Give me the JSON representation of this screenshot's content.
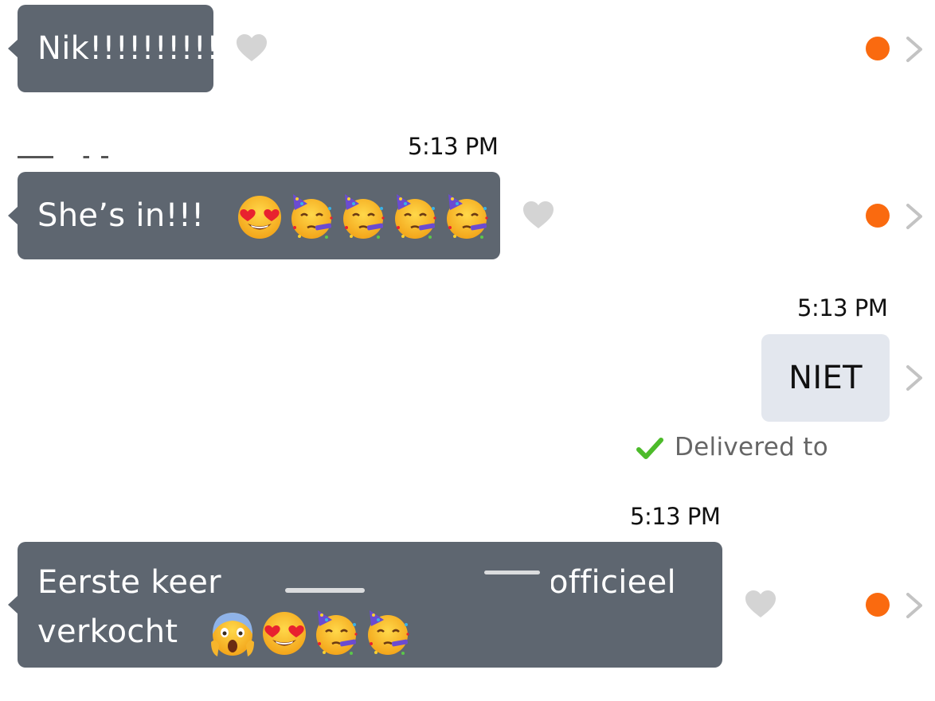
{
  "colors": {
    "incoming_bubble": "#5e6670",
    "outgoing_bubble": "#e3e7ee",
    "unread_dot": "#fa6a0f",
    "heart": "#d4d4d4",
    "chevron": "#c3c3c3",
    "delivered_check": "#4cbb2a"
  },
  "messages": [
    {
      "direction": "incoming",
      "text": "Nik!!!!!!!!!!",
      "emojis": [],
      "liked_icon": "heart-icon",
      "unread": true
    },
    {
      "direction": "incoming",
      "timestamp": "5:13 PM",
      "text": "She’s in!!!",
      "emojis": [
        "heart-eyes-emoji",
        "partying-face-emoji",
        "partying-face-emoji",
        "partying-face-emoji",
        "partying-face-emoji"
      ],
      "liked_icon": "heart-icon",
      "unread": true
    },
    {
      "direction": "outgoing",
      "timestamp": "5:13 PM",
      "text": "NIET",
      "status_icon": "checkmark-icon",
      "status": "Delivered to"
    },
    {
      "direction": "incoming",
      "timestamp": "5:13 PM",
      "text_line1_start": "Eerste keer",
      "text_line1_end": "officieel",
      "text_line2": "verkocht",
      "emojis": [
        "screaming-face-emoji",
        "heart-eyes-emoji",
        "partying-face-emoji",
        "partying-face-emoji"
      ],
      "liked_icon": "heart-icon",
      "unread": true
    }
  ]
}
